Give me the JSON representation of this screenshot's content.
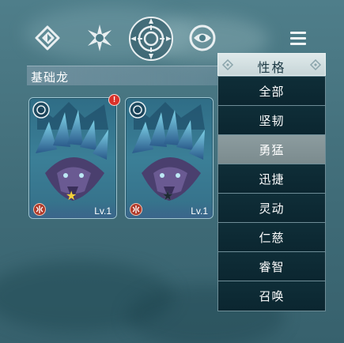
{
  "tabs": [
    {
      "icon": "tide-crest-icon",
      "selected": false
    },
    {
      "icon": "thorn-crest-icon",
      "selected": false
    },
    {
      "icon": "sun-crest-icon",
      "selected": true
    },
    {
      "icon": "eye-crest-icon",
      "selected": false
    }
  ],
  "menu_icon": "menu-icon",
  "section_title": "基础龙",
  "cards": [
    {
      "level": "Lv.1",
      "star": "★",
      "star_color": "#f5d23a",
      "has_alert": true,
      "alert": "!"
    },
    {
      "level": "Lv.1",
      "star": "★",
      "star_color": "#1f2b33",
      "has_alert": false
    }
  ],
  "dropdown": {
    "header": "性格",
    "options": [
      "全部",
      "坚韧",
      "勇猛",
      "迅捷",
      "灵动",
      "仁慈",
      "睿智",
      "召唤"
    ],
    "selected": "勇猛"
  },
  "colors": {
    "alert": "#d9312a",
    "selected_row": "#8c9c9f",
    "row_bg": "#0d2a33"
  }
}
